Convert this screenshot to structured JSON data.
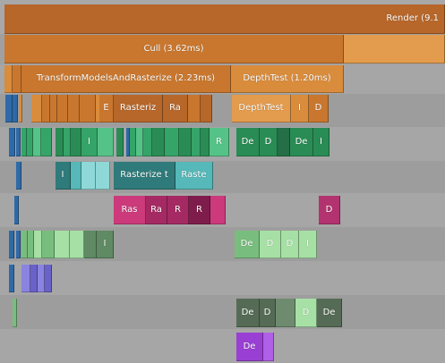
{
  "profiler": {
    "render_label": "Render (9.1",
    "cull_label": "Cull (3.62ms)",
    "transform_label": "TransformModelsAndRasterize (2.23ms)",
    "depthtest_label": "DepthTest (1.20ms)",
    "row4": {
      "small_e": "E",
      "rasteriz": "Rasteriz",
      "ra": "Ra",
      "depthtest": "DepthTest",
      "i": "I",
      "d": "D"
    },
    "row5": {
      "i": "I",
      "r": "R",
      "de": "De",
      "d": "D",
      "de2": "De",
      "i2": "I"
    },
    "row6": {
      "i": "I",
      "rasterize_t": "Rasterize t",
      "raste": "Raste"
    },
    "row7": {
      "ras": "Ras",
      "ra": "Ra",
      "r1": "R",
      "r2": "R",
      "d": "D"
    },
    "row8": {
      "i": "I",
      "de": "De",
      "d": "D",
      "d2": "D",
      "i2": "I"
    },
    "row10": {
      "de": "De",
      "d": "D",
      "d2": "D",
      "de2": "De"
    },
    "row11": {
      "de": "De"
    }
  }
}
